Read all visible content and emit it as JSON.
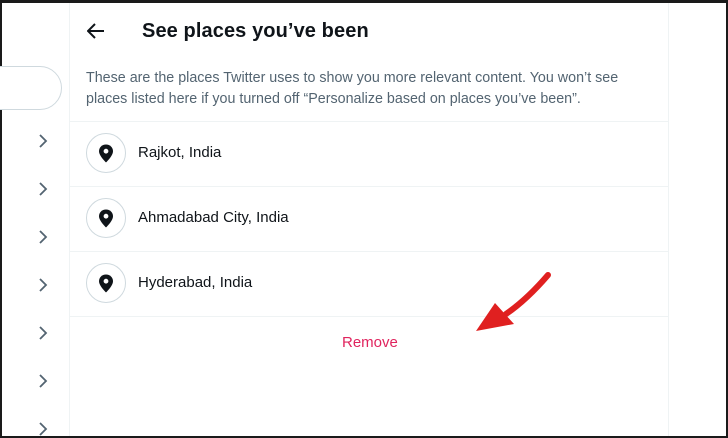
{
  "header": {
    "back_icon": "arrow-left-icon",
    "title": "See places you’ve been"
  },
  "description": "These are the places Twitter uses to show you more relevant content. You won’t see places listed here if you turned off “Personalize based on places you’ve been”.",
  "places": [
    {
      "label": "Rajkot, India",
      "icon": "location-pin-icon"
    },
    {
      "label": "Ahmadabad City, India",
      "icon": "location-pin-icon"
    },
    {
      "label": "Hyderabad, India",
      "icon": "location-pin-icon"
    }
  ],
  "actions": {
    "remove_label": "Remove"
  },
  "sidebar": {
    "chevron_icon": "chevron-right-icon"
  },
  "colors": {
    "remove": "#e0245e",
    "annotation_arrow": "#e02020",
    "secondary_text": "#536471"
  }
}
